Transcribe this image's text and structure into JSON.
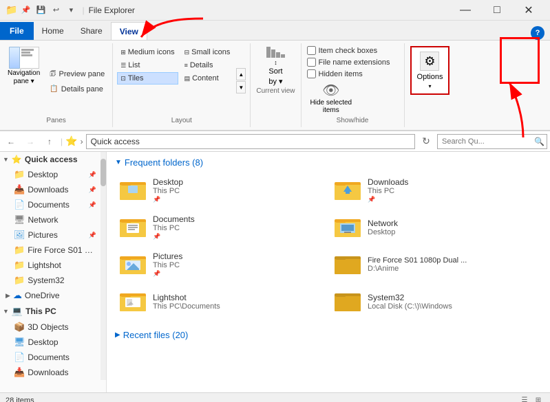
{
  "titleBar": {
    "title": "File Explorer",
    "minBtn": "—",
    "maxBtn": "□",
    "closeBtn": "✕"
  },
  "qat": {
    "items": [
      "📌",
      "💾",
      "↩",
      "↪",
      "▼"
    ]
  },
  "ribbon": {
    "tabs": [
      "File",
      "Home",
      "Share",
      "View"
    ],
    "activeTab": "View",
    "groups": {
      "panes": {
        "label": "Panes",
        "navigationPane": "Navigation\npane",
        "previewPane": "Preview pane",
        "detailsPane": "Details pane"
      },
      "layout": {
        "label": "Layout",
        "items": [
          {
            "label": "Medium icons",
            "active": false
          },
          {
            "label": "Small icons",
            "active": false
          },
          {
            "label": "List",
            "active": false
          },
          {
            "label": "Details",
            "active": false
          },
          {
            "label": "Tiles",
            "active": true
          },
          {
            "label": "Content",
            "active": false
          }
        ]
      },
      "sort": {
        "label": "Current view",
        "sortLabel": "Sort\nby"
      },
      "currentView": {
        "label": "Current view"
      },
      "showHide": {
        "label": "Show/hide",
        "itemCheckBoxes": "Item check boxes",
        "fileNameExtensions": "File name extensions",
        "hiddenItems": "Hidden items"
      },
      "hideSelected": {
        "label": "Show/hide",
        "btnLabel": "Hide selected\nitems"
      },
      "options": {
        "label": "",
        "btnLabel": "Options"
      }
    }
  },
  "addressBar": {
    "backDisabled": false,
    "forwardDisabled": true,
    "upBtn": "↑",
    "path": "Quick access",
    "searchPlaceholder": "Search Qu...",
    "searchIcon": "🔍"
  },
  "sidebar": {
    "items": [
      {
        "id": "quick-access",
        "label": "Quick access",
        "icon": "⭐",
        "indent": 0,
        "isSection": true,
        "active": true
      },
      {
        "id": "desktop",
        "label": "Desktop",
        "icon": "📁",
        "indent": 1,
        "pin": true
      },
      {
        "id": "downloads",
        "label": "Downloads",
        "icon": "📁",
        "indent": 1,
        "pin": true
      },
      {
        "id": "documents",
        "label": "Documents",
        "icon": "📁",
        "indent": 1,
        "pin": true
      },
      {
        "id": "network",
        "label": "Network",
        "icon": "🖧",
        "indent": 1,
        "pin": false
      },
      {
        "id": "pictures",
        "label": "Pictures",
        "icon": "📁",
        "indent": 1,
        "pin": true
      },
      {
        "id": "fire-force",
        "label": "Fire Force S01 10...",
        "icon": "📁",
        "indent": 1,
        "pin": false
      },
      {
        "id": "lightshot",
        "label": "Lightshot",
        "icon": "📁",
        "indent": 1,
        "pin": false
      },
      {
        "id": "system32",
        "label": "System32",
        "icon": "📁",
        "indent": 1,
        "pin": false
      },
      {
        "id": "onedrive",
        "label": "OneDrive",
        "icon": "☁",
        "indent": 0,
        "isSection": false
      },
      {
        "id": "this-pc",
        "label": "This PC",
        "icon": "💻",
        "indent": 0,
        "isSection": true
      },
      {
        "id": "3d-objects",
        "label": "3D Objects",
        "icon": "📁",
        "indent": 1,
        "pin": false
      },
      {
        "id": "desktop2",
        "label": "Desktop",
        "icon": "📁",
        "indent": 1,
        "pin": false
      },
      {
        "id": "documents2",
        "label": "Documents",
        "icon": "📁",
        "indent": 1,
        "pin": false
      },
      {
        "id": "downloads2",
        "label": "Downloads",
        "icon": "📁",
        "indent": 1,
        "pin": false
      }
    ]
  },
  "content": {
    "frequentFolders": {
      "label": "Frequent folders (8)",
      "items": [
        {
          "name": "Desktop",
          "sub": "This PC",
          "pin": true,
          "col": 0
        },
        {
          "name": "Downloads",
          "sub": "This PC",
          "pin": true,
          "col": 1
        },
        {
          "name": "Documents",
          "sub": "This PC",
          "pin": true,
          "col": 0
        },
        {
          "name": "Network",
          "sub": "Desktop",
          "pin": false,
          "col": 1
        },
        {
          "name": "Pictures",
          "sub": "This PC",
          "pin": true,
          "col": 0
        },
        {
          "name": "Fire Force S01 1080p Dual ...",
          "sub": "D:\\Anime",
          "pin": false,
          "col": 1
        },
        {
          "name": "Lightshot",
          "sub": "This PC\\Documents",
          "pin": false,
          "col": 0
        },
        {
          "name": "System32",
          "sub": "Local Disk (C:\\)\\Windows",
          "pin": false,
          "col": 1
        }
      ]
    },
    "recentFiles": {
      "label": "Recent files (20)",
      "collapsed": true
    }
  },
  "statusBar": {
    "itemCount": "28 items",
    "viewIcons": [
      "☰",
      "⊞"
    ]
  },
  "annotations": {
    "viewTabArrow": "↗",
    "optionsRedBox": true
  }
}
